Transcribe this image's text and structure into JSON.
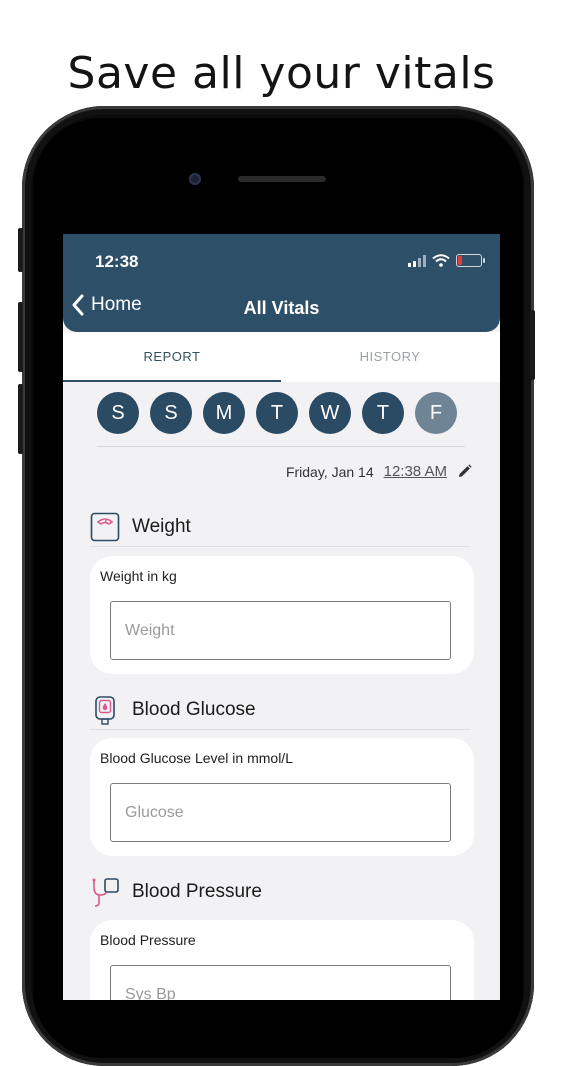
{
  "headline": "Save all your vitals",
  "status_bar": {
    "time": "12:38"
  },
  "nav": {
    "back_label": "Home",
    "title": "All Vitals"
  },
  "tabs": [
    {
      "label": "REPORT",
      "active": true
    },
    {
      "label": "HISTORY",
      "active": false
    }
  ],
  "days": [
    {
      "label": "S",
      "active": false
    },
    {
      "label": "S",
      "active": false
    },
    {
      "label": "M",
      "active": false
    },
    {
      "label": "T",
      "active": false
    },
    {
      "label": "W",
      "active": false
    },
    {
      "label": "T",
      "active": false
    },
    {
      "label": "F",
      "active": true
    }
  ],
  "date": {
    "day_text": "Friday, Jan 14",
    "time_text": "12:38 AM"
  },
  "sections": [
    {
      "icon": "weight-scale-icon",
      "title": "Weight",
      "field_label": "Weight in kg",
      "placeholder": "Weight"
    },
    {
      "icon": "glucose-meter-icon",
      "title": "Blood Glucose",
      "field_label": "Blood Glucose Level in mmol/L",
      "placeholder": "Glucose"
    },
    {
      "icon": "blood-pressure-icon",
      "title": "Blood Pressure",
      "field_label": "Blood Pressure",
      "placeholder": "Sys Bp"
    }
  ],
  "colors": {
    "nav_bg": "#2e4f68",
    "day_bg": "#2b4a63",
    "day_active_bg": "#6f8595",
    "icon_accent": "#d85a8a"
  }
}
